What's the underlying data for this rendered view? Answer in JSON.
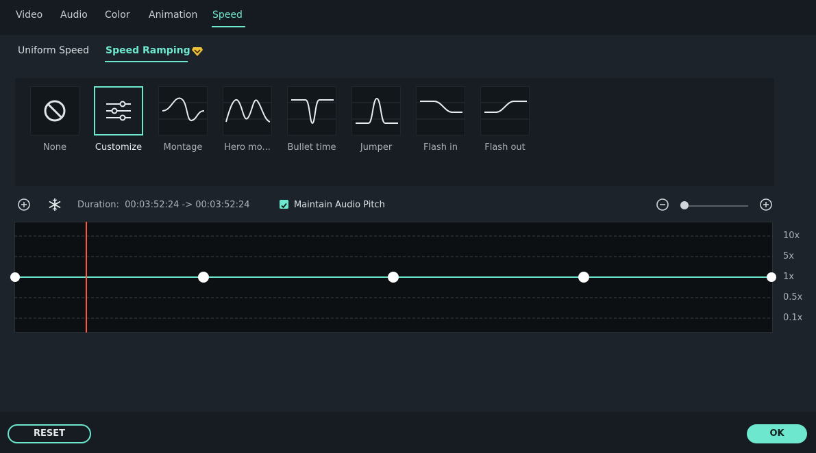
{
  "tabs": [
    "Video",
    "Audio",
    "Color",
    "Animation",
    "Speed"
  ],
  "active_tab": "Speed",
  "subtabs": {
    "uniform": "Uniform Speed",
    "ramping": "Speed Ramping"
  },
  "presets": [
    "None",
    "Customize",
    "Montage",
    "Hero mo...",
    "Bullet time",
    "Jumper",
    "Flash in",
    "Flash out"
  ],
  "selected_preset": "Customize",
  "toolbar": {
    "duration_label": "Duration:",
    "duration_value": "00:03:52:24 -> 00:03:52:24",
    "maintain_pitch_label": "Maintain Audio Pitch",
    "maintain_pitch_checked": true,
    "zoom_level": 0
  },
  "graph": {
    "y_labels": [
      "10x",
      "5x",
      "1x",
      "0.5x",
      "0.1x"
    ],
    "keyframe_speed": "1x",
    "keyframe_count": 5
  },
  "buttons": {
    "reset": "RESET",
    "ok": "OK"
  },
  "colors": {
    "accent": "#6ee7cf",
    "playhead": "#ff5a3c",
    "badge": "#f0c23a"
  }
}
